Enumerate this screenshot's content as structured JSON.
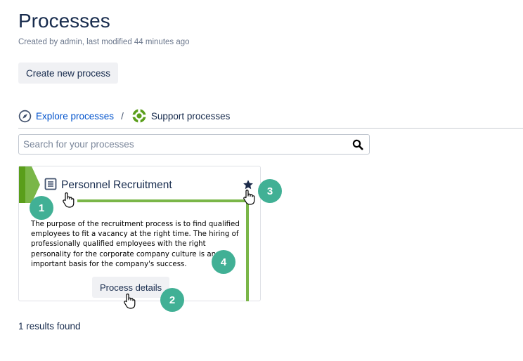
{
  "page": {
    "title": "Processes",
    "byline": "Created by admin, last modified 44 minutes ago"
  },
  "actions": {
    "create_label": "Create new process"
  },
  "breadcrumb": {
    "explore_label": "Explore processes",
    "separator": "/",
    "current_label": "Support processes"
  },
  "search": {
    "placeholder": "Search for your processes",
    "value": ""
  },
  "card": {
    "title": "Personnel Recruitment",
    "description": "The purpose of the recruitment process is to find qualified employees to fit a vacancy at the right time. The hiring of professionally qualified employees with the right personality for the corporate company culture is an important basis for the company's success.",
    "details_label": "Process details"
  },
  "callouts": {
    "one": "1",
    "two": "2",
    "three": "3",
    "four": "4"
  },
  "results": {
    "text": "1 results found"
  },
  "icons": {
    "explore": "compass-icon",
    "support": "lifebuoy-icon",
    "search": "magnifier-icon",
    "card_type": "document-icon",
    "favorite": "star-icon",
    "pointer": "hand-cursor-icon"
  },
  "colors": {
    "heading": "#172b4d",
    "link": "#0052cc",
    "process_green": "#5a9e1a",
    "frame_green": "#7ab648",
    "callout": "#41b095",
    "button_bg": "#f0f1f4"
  }
}
